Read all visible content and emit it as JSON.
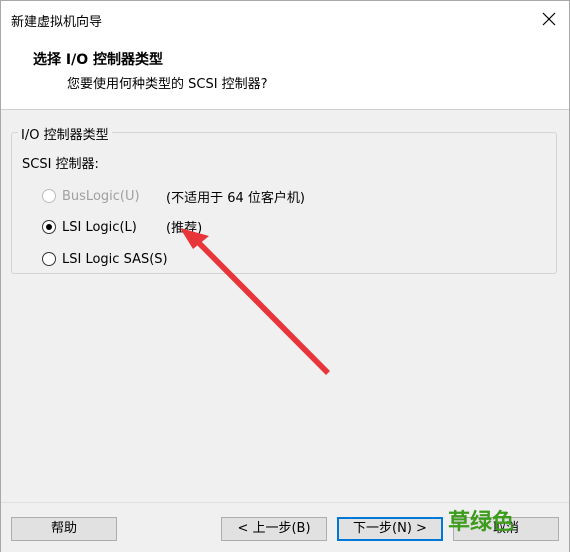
{
  "window": {
    "title": "新建虚拟机向导"
  },
  "header": {
    "title": "选择 I/O 控制器类型",
    "subtitle": "您要使用何种类型的 SCSI 控制器?"
  },
  "group": {
    "legend": "I/O 控制器类型",
    "subheading": "SCSI 控制器:",
    "options": [
      {
        "label": "BusLogic(U)",
        "note": "(不适用于 64 位客户机)",
        "checked": false,
        "disabled": true
      },
      {
        "label": "LSI Logic(L)",
        "note": "(推荐)",
        "checked": true,
        "disabled": false
      },
      {
        "label": "LSI Logic SAS(S)",
        "note": "",
        "checked": false,
        "disabled": false
      }
    ]
  },
  "buttons": {
    "help": "帮助",
    "back": "< 上一步(B)",
    "next": "下一步(N) >",
    "cancel": "取消"
  },
  "watermark": {
    "text": "草绿色"
  },
  "colors": {
    "arrow": "#e8353a",
    "accent": "#0078d7",
    "watermark": "#3c9c1c"
  },
  "icons": {
    "close": "close-icon"
  }
}
